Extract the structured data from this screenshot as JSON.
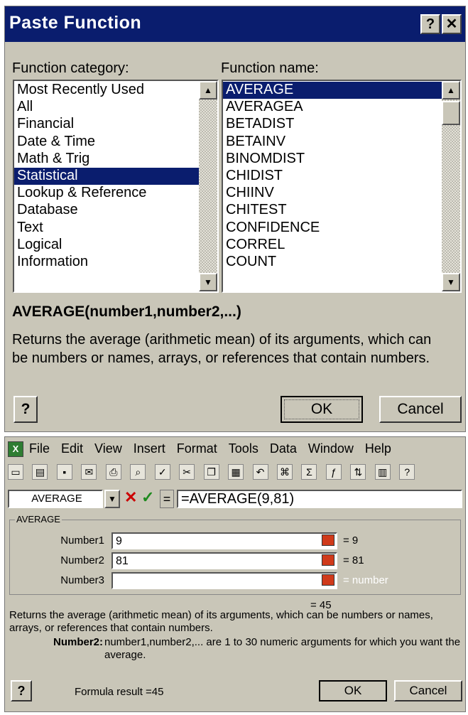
{
  "paste_function": {
    "title": "Paste Function",
    "help_title_btn": "?",
    "close_btn": "✕",
    "category_label": "Function category:",
    "name_label": "Function name:",
    "categories": [
      "Most Recently Used",
      "All",
      "Financial",
      "Date & Time",
      "Math & Trig",
      "Statistical",
      "Lookup & Reference",
      "Database",
      "Text",
      "Logical",
      "Information"
    ],
    "selected_category": "Statistical",
    "functions": [
      "AVERAGE",
      "AVERAGEA",
      "BETADIST",
      "BETAINV",
      "BINOMDIST",
      "CHIDIST",
      "CHIINV",
      "CHITEST",
      "CONFIDENCE",
      "CORREL",
      "COUNT"
    ],
    "selected_function": "AVERAGE",
    "signature": "AVERAGE(number1,number2,...)",
    "description": "Returns the average (arithmetic mean) of its arguments, which can be numbers or names, arrays, or references that contain numbers.",
    "help_btn": "?",
    "ok": "OK",
    "cancel": "Cancel"
  },
  "excel": {
    "menu": [
      "File",
      "Edit",
      "View",
      "Insert",
      "Format",
      "Tools",
      "Data",
      "Window",
      "Help"
    ],
    "name_box": "AVERAGE",
    "formula": "=AVERAGE(9,81)",
    "group_title": "AVERAGE",
    "args": [
      {
        "label": "Number1",
        "value": "9",
        "result": "= 9"
      },
      {
        "label": "Number2",
        "value": "81",
        "result": "= 81"
      },
      {
        "label": "Number3",
        "value": "",
        "result": "= number"
      }
    ],
    "total": "= 45",
    "desc": "Returns the average (arithmetic mean) of its arguments, which can be numbers or names, arrays, or references that contain numbers.",
    "arg_help_label": "Number2:",
    "arg_help": "number1,number2,... are 1 to 30 numeric arguments for which you want the average.",
    "formula_result": "Formula result =45",
    "help_btn": "?",
    "ok": "OK",
    "cancel": "Cancel",
    "colors": {
      "title_blue": "#0a1d6e",
      "dialog_gray": "#c9c6b8"
    }
  }
}
